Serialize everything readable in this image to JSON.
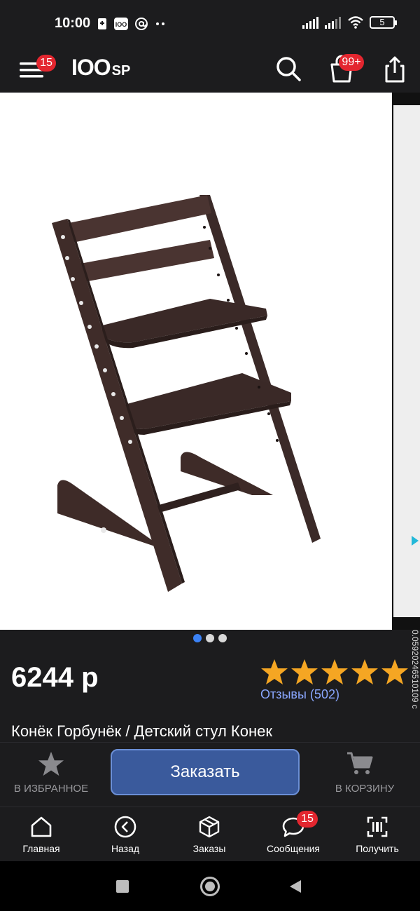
{
  "status_bar": {
    "time": "10:00",
    "battery_level": "5",
    "icons": [
      "sim-icon",
      "100sp-notification-icon",
      "at-icon",
      "more-dots-icon",
      "signal-icon",
      "signal-icon",
      "wifi-icon",
      "battery-icon"
    ]
  },
  "header": {
    "menu_badge": "15",
    "logo_main": "IOO",
    "logo_sp": "SP",
    "cart_badge": "99+"
  },
  "gallery": {
    "image_subject": "wooden-high-chair",
    "dots": [
      true,
      false,
      false
    ]
  },
  "product": {
    "price": "6244 р",
    "rating_stars": 5,
    "reviews": "Отзывы (502)",
    "side_code": "0.05920246510109 c",
    "title": "Конёк Горбунёк / Детский стул Конек"
  },
  "actions": {
    "favorites": "В ИЗБРАННОЕ",
    "order": "Заказать",
    "add_to_cart": "В КОРЗИНУ"
  },
  "bottom_nav": {
    "home": "Главная",
    "back": "Назад",
    "orders": "Заказы",
    "messages": "Сообщения",
    "messages_badge": "15",
    "receive": "Получить"
  },
  "colors": {
    "background": "#1c1c1e",
    "badge": "#e3262f",
    "order_button": "#3a5a9c",
    "star": "#f5a623",
    "link": "#8aa7ff",
    "dot_active": "#3b82f6"
  }
}
